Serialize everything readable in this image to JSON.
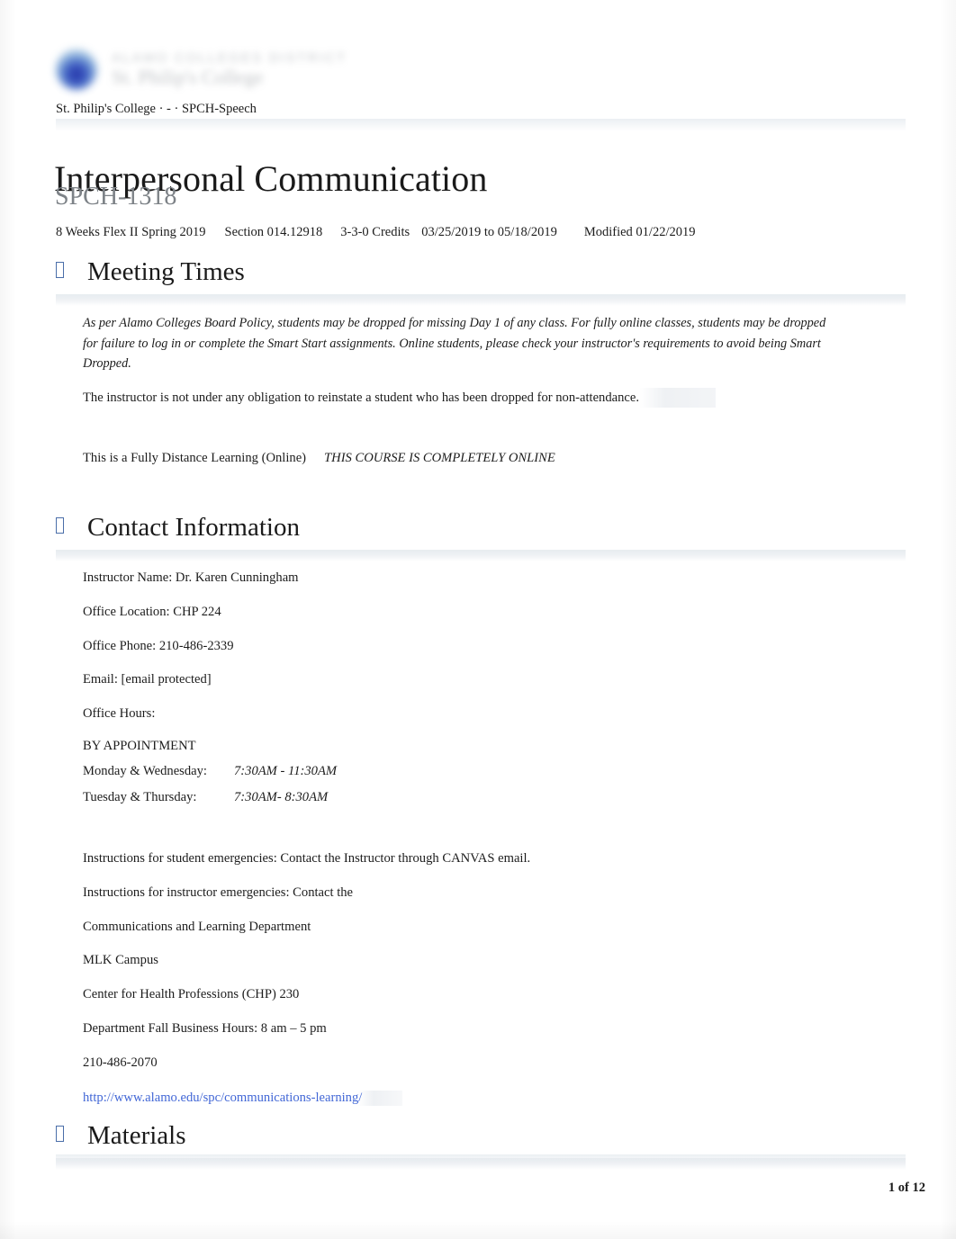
{
  "header": {
    "logo_icon": "alamo-colleges-seal-logo",
    "wordmark_line1": "ALAMO COLLEGES DISTRICT",
    "wordmark_line2": "St. Philip's College",
    "breadcrumb": "St. Philip's College · - · SPCH-Speech"
  },
  "title": {
    "course_name": "Interpersonal Communication",
    "course_code": "SPCH-1318"
  },
  "meta": {
    "term": "8 Weeks Flex II Spring 2019",
    "section": "Section 014.12918",
    "credits": "3-3-0 Credits",
    "dates": "03/25/2019 to 05/18/2019",
    "modified": "Modified 01/22/2019"
  },
  "sections": [
    {
      "icon": "section-bullet-icon",
      "label": "Meeting Times"
    },
    {
      "icon": "section-bullet-icon",
      "label": "Contact Information"
    },
    {
      "icon": "section-bullet-icon",
      "label": "Materials"
    }
  ],
  "meeting_times": {
    "policy_paragraph": "As per Alamo Colleges Board Policy, students may be dropped for missing Day 1 of any class. For fully online classes, students may be dropped for failure to log in or complete the Smart Start assignments. Online students, please check your instructor's requirements to avoid being Smart Dropped.",
    "warning": "The instructor is not under any obligation to reinstate a student who has been dropped for non-attendance.",
    "delivery_label": "This is a Fully Distance Learning (Online)",
    "delivery_emphasis": "THIS COURSE IS COMPLETELY ONLINE"
  },
  "contact": {
    "instructor_name": "Instructor Name: Dr. Karen Cunningham",
    "office_location": "Office Location: CHP 224",
    "office_phone": "Office Phone: 210-486-2339",
    "email": "Email: [email protected]",
    "office_hours_label": "Office Hours:",
    "by_appointment": "BY APPOINTMENT",
    "hours": [
      {
        "days": "Monday & Wednesday:",
        "time": "7:30AM - 11:30AM"
      },
      {
        "days": "Tuesday & Thursday:",
        "time": "7:30AM- 8:30AM"
      }
    ],
    "student_emergencies": "Instructions for student emergencies: Contact the Instructor through CANVAS email.",
    "instructor_emergencies": "Instructions for instructor emergencies: Contact the",
    "department": "Communications and Learning Department",
    "campus": "MLK Campus",
    "building": "Center for Health Professions (CHP) 230",
    "business_hours": "Department Fall Business Hours: 8 am – 5 pm",
    "department_phone": "210-486-2070",
    "department_url": "http://www.alamo.edu/spc/communications-learning/"
  },
  "footer": {
    "page_number": "1 of 12"
  },
  "colors": {
    "accent_blue": "#4a6ea9",
    "link_blue": "#4267d6",
    "warning_red": "#e8281e",
    "muted_gray": "#7d8287",
    "rule_band": "#e8ecf0"
  }
}
